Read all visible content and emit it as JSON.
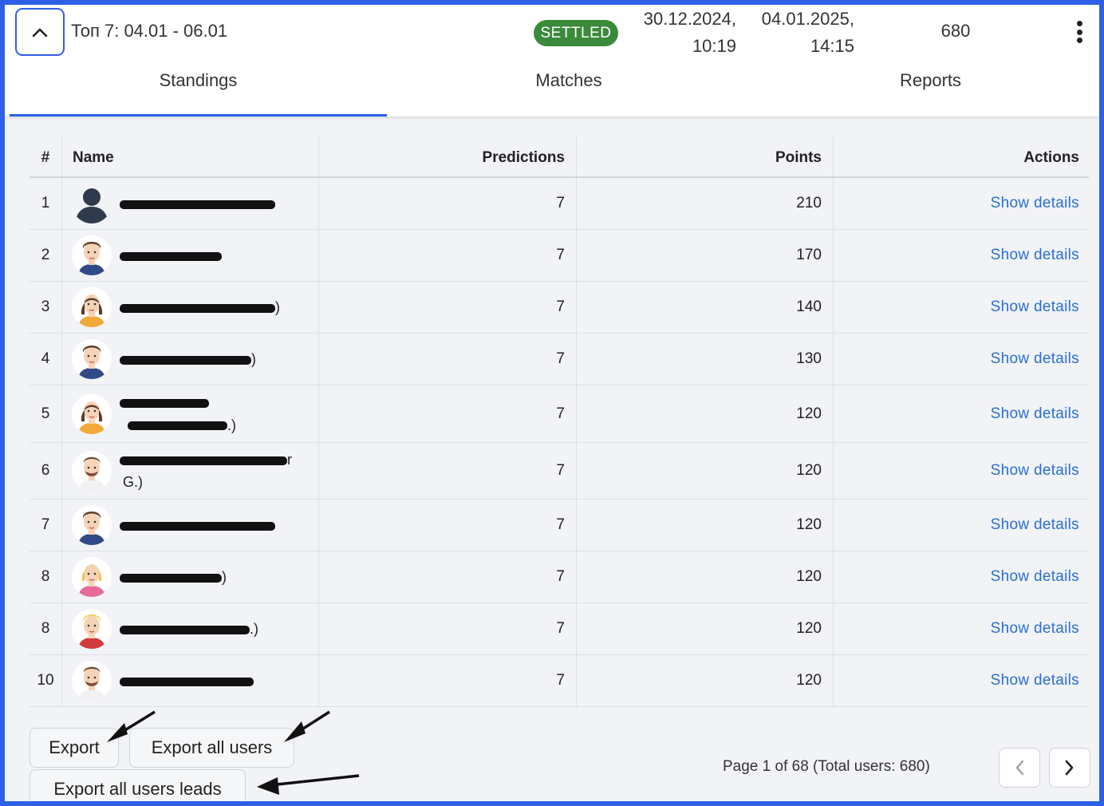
{
  "header": {
    "title": "Топ 7: 04.01 - 06.01",
    "status": "SETTLED",
    "start_date": "30.12.2024,",
    "start_time": "10:19",
    "end_date": "04.01.2025,",
    "end_time": "14:15",
    "total": "680"
  },
  "tabs": [
    {
      "label": "Standings",
      "active": true
    },
    {
      "label": "Matches",
      "active": false
    },
    {
      "label": "Reports",
      "active": false
    }
  ],
  "table": {
    "columns": [
      "#",
      "Name",
      "Predictions",
      "Points",
      "Actions"
    ],
    "rows": [
      {
        "rank": "1",
        "name_suffix": "",
        "predictions": "7",
        "points": "210",
        "action": "Show details",
        "avatar": "silhouette-avatar"
      },
      {
        "rank": "2",
        "name_suffix": "",
        "predictions": "7",
        "points": "170",
        "action": "Show details",
        "avatar": "man-avatar"
      },
      {
        "rank": "3",
        "name_suffix": ")",
        "predictions": "7",
        "points": "140",
        "action": "Show details",
        "avatar": "woman-avatar"
      },
      {
        "rank": "4",
        "name_suffix": ")",
        "predictions": "7",
        "points": "130",
        "action": "Show details",
        "avatar": "man-avatar"
      },
      {
        "rank": "5",
        "name_suffix": ".)",
        "predictions": "7",
        "points": "120",
        "action": "Show details",
        "avatar": "woman-avatar"
      },
      {
        "rank": "6",
        "name_suffix": "r",
        "name_suffix_2": "G.)",
        "predictions": "7",
        "points": "120",
        "action": "Show details",
        "avatar": "bearded-man-avatar"
      },
      {
        "rank": "7",
        "name_suffix": "",
        "predictions": "7",
        "points": "120",
        "action": "Show details",
        "avatar": "man-avatar"
      },
      {
        "rank": "8",
        "name_suffix": ")",
        "predictions": "7",
        "points": "120",
        "action": "Show details",
        "avatar": "blonde-woman-avatar"
      },
      {
        "rank": "8",
        "name_suffix": ".)",
        "predictions": "7",
        "points": "120",
        "action": "Show details",
        "avatar": "blonde-man-avatar"
      },
      {
        "rank": "10",
        "name_suffix": "",
        "predictions": "7",
        "points": "120",
        "action": "Show details",
        "avatar": "bearded-man-avatar"
      }
    ]
  },
  "buttons": {
    "export": "Export",
    "export_all": "Export all users",
    "export_leads": "Export all users leads"
  },
  "pagination": {
    "info": "Page 1 of 68 (Total users: 680)"
  },
  "colors": {
    "accent": "#2f5fe6",
    "status": "#3a8a3c",
    "link": "#2a6fd1"
  }
}
